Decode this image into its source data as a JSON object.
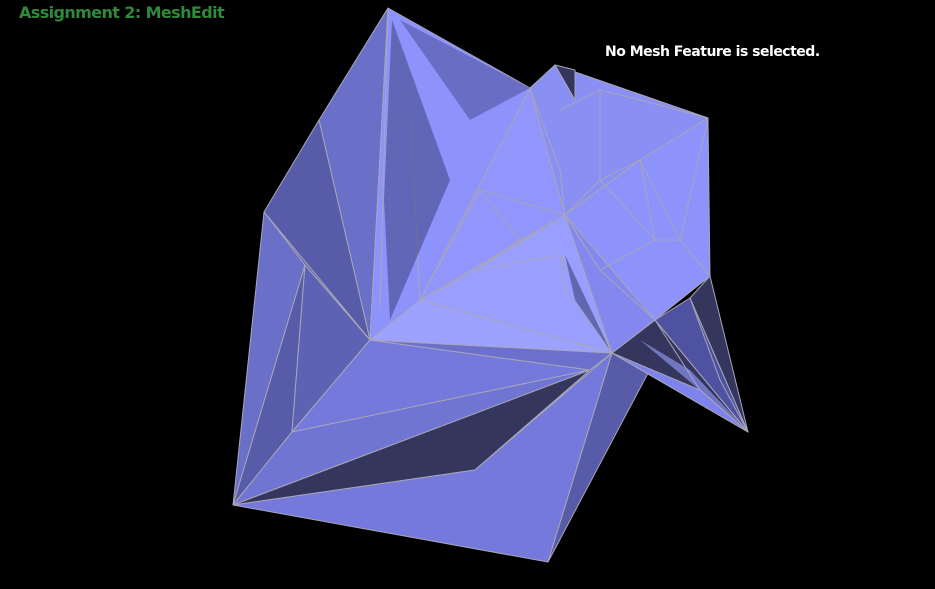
{
  "app": {
    "title": "Assignment 2: MeshEdit"
  },
  "status": {
    "message": "No Mesh Feature is selected."
  },
  "viewport": {
    "background": "#000000",
    "mesh_colors": {
      "lit": "#8e93fb",
      "bright": "#9da1ff",
      "mid": "#7579db",
      "side": "#6a6fc8",
      "dark": "#585ba7",
      "shadow": "#34365e",
      "edge": "#a6a6b8"
    },
    "title_color": "#2f8a3a",
    "status_color": "#ffffff"
  }
}
